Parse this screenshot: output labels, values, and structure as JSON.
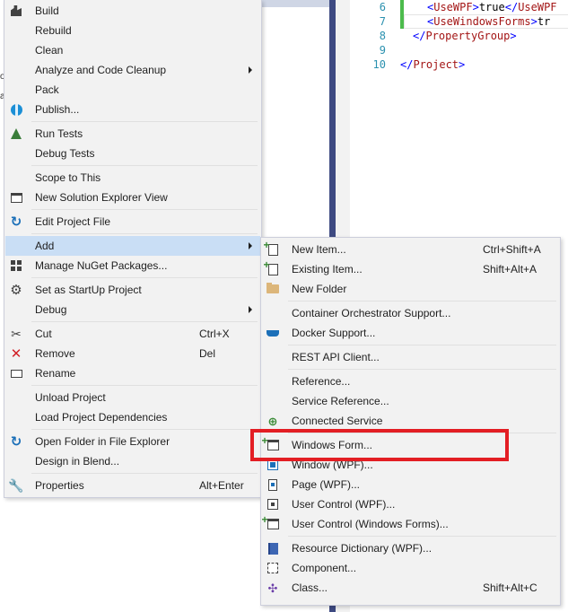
{
  "editor": {
    "lines": [
      {
        "num": "6",
        "open": "UseWPF",
        "value": "true",
        "close": "UseWPF"
      },
      {
        "num": "7",
        "open": "UseWindowsForms",
        "value": "tr",
        "close": ""
      },
      {
        "num": "8",
        "close_tag": "PropertyGroup"
      },
      {
        "num": "9"
      },
      {
        "num": "10",
        "close_tag": "Project"
      }
    ],
    "left_sliver": [
      "o",
      "a"
    ]
  },
  "main_menu": {
    "items": {
      "build": {
        "label": "Build",
        "icon": "build-icon"
      },
      "rebuild": {
        "label": "Rebuild"
      },
      "clean": {
        "label": "Clean"
      },
      "analyze": {
        "label": "Analyze and Code Cleanup"
      },
      "pack": {
        "label": "Pack"
      },
      "publish": {
        "label": "Publish...",
        "icon": "globe-icon"
      },
      "run_tests": {
        "label": "Run Tests",
        "icon": "flask-icon"
      },
      "debug_tests": {
        "label": "Debug Tests"
      },
      "scope": {
        "label": "Scope to This"
      },
      "new_view": {
        "label": "New Solution Explorer View",
        "icon": "window-icon"
      },
      "edit_project": {
        "label": "Edit Project File",
        "icon": "edit-arrow-icon"
      },
      "add": {
        "label": "Add"
      },
      "nuget": {
        "label": "Manage NuGet Packages...",
        "icon": "nuget-icon"
      },
      "startup": {
        "label": "Set as StartUp Project",
        "icon": "gear-icon"
      },
      "debug": {
        "label": "Debug"
      },
      "cut": {
        "label": "Cut",
        "shortcut": "Ctrl+X",
        "icon": "scissors-icon"
      },
      "remove": {
        "label": "Remove",
        "shortcut": "Del",
        "icon": "remove-icon"
      },
      "rename": {
        "label": "Rename",
        "icon": "rename-icon"
      },
      "unload": {
        "label": "Unload Project"
      },
      "load_deps": {
        "label": "Load Project Dependencies"
      },
      "open_folder": {
        "label": "Open Folder in File Explorer",
        "icon": "open-folder-icon"
      },
      "blend": {
        "label": "Design in Blend..."
      },
      "properties": {
        "label": "Properties",
        "shortcut": "Alt+Enter",
        "icon": "wrench-icon"
      }
    }
  },
  "sub_menu": {
    "items": {
      "new_item": {
        "label": "New Item...",
        "shortcut": "Ctrl+Shift+A"
      },
      "existing_item": {
        "label": "Existing Item...",
        "shortcut": "Shift+Alt+A"
      },
      "new_folder": {
        "label": "New Folder"
      },
      "container": {
        "label": "Container Orchestrator Support..."
      },
      "docker": {
        "label": "Docker Support..."
      },
      "rest": {
        "label": "REST API Client..."
      },
      "reference": {
        "label": "Reference..."
      },
      "service_reference": {
        "label": "Service Reference..."
      },
      "connected_service": {
        "label": "Connected Service"
      },
      "windows_form": {
        "label": "Windows Form..."
      },
      "window_wpf": {
        "label": "Window (WPF)..."
      },
      "page_wpf": {
        "label": "Page (WPF)..."
      },
      "user_control_wpf": {
        "label": "User Control (WPF)..."
      },
      "user_control_wf": {
        "label": "User Control (Windows Forms)..."
      },
      "resource_dictionary": {
        "label": "Resource Dictionary (WPF)..."
      },
      "component": {
        "label": "Component..."
      },
      "class": {
        "label": "Class...",
        "shortcut": "Shift+Alt+C"
      }
    }
  },
  "colors": {
    "menu_bg": "#f2f2f2",
    "hover_bg": "#c9def5",
    "highlight_border": "#e31e24",
    "accent_stripe": "#3e4a82",
    "tag_color": "#a31515",
    "bracket_color": "#0000ff",
    "line_number_color": "#2b91af"
  }
}
